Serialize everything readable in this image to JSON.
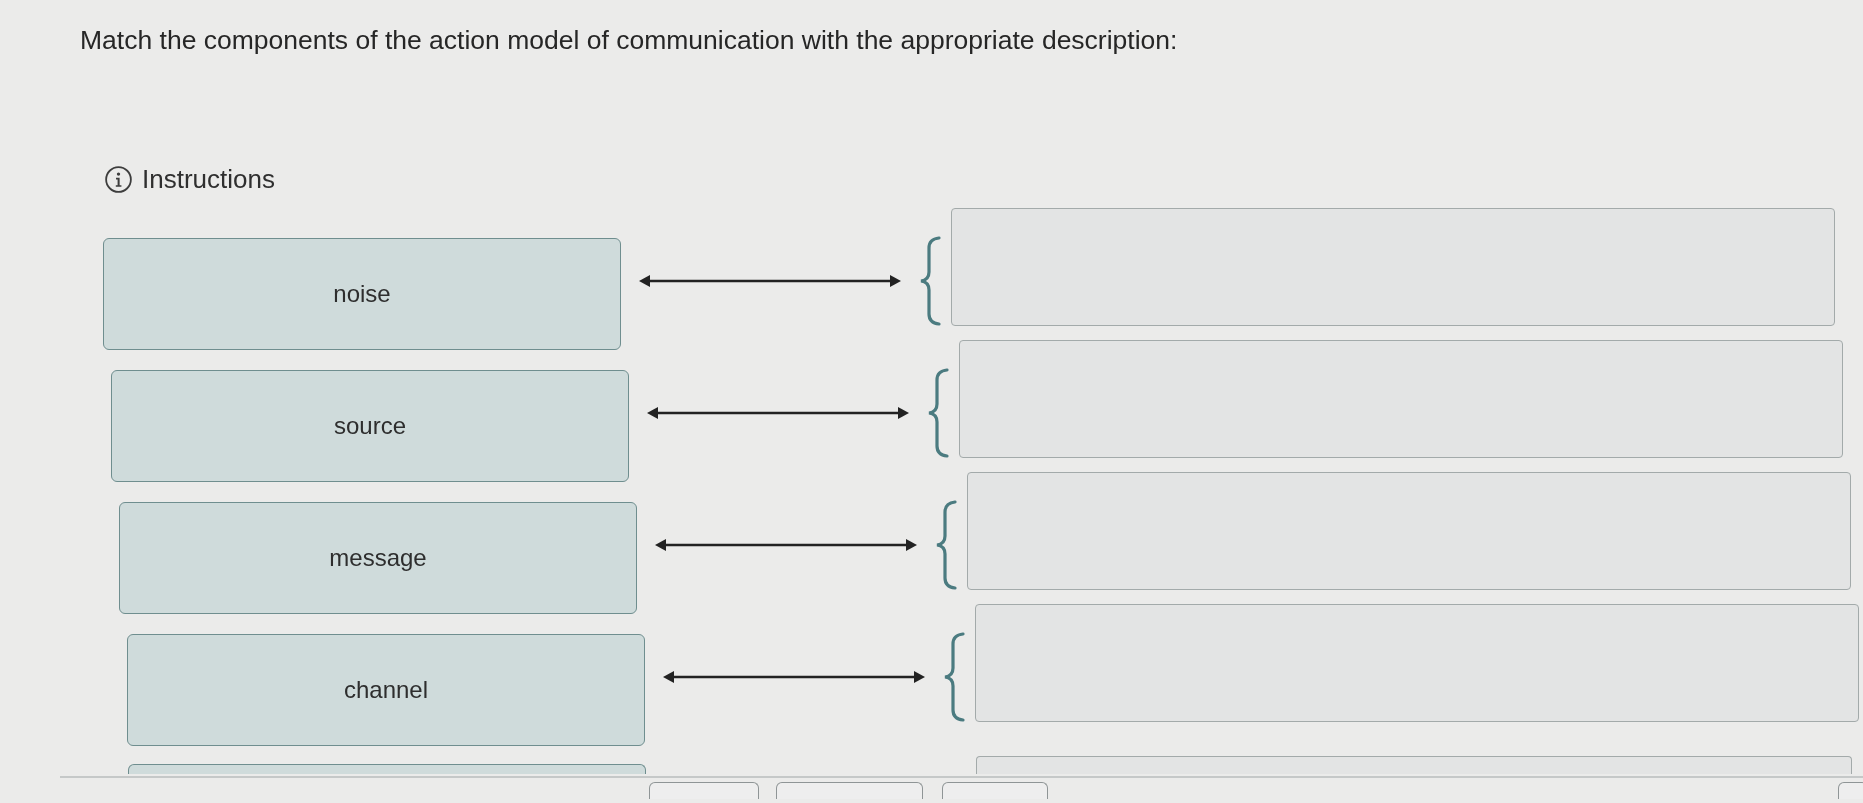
{
  "question": {
    "prompt": "Match the components of the action model of communication with the appropriate description:"
  },
  "instructions": {
    "label": "Instructions"
  },
  "pairs": [
    {
      "term": "noise"
    },
    {
      "term": "source"
    },
    {
      "term": "message"
    },
    {
      "term": "channel"
    }
  ]
}
